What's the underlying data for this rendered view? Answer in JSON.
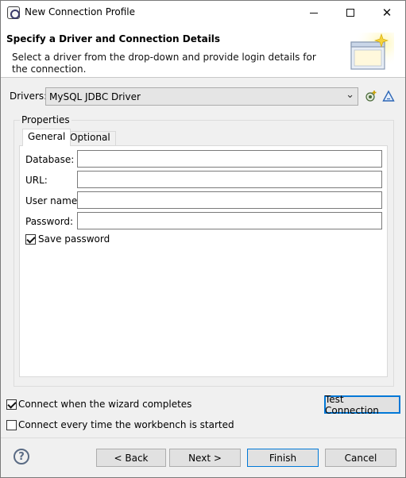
{
  "window": {
    "title": "New Connection Profile"
  },
  "header": {
    "title": "Specify a Driver and Connection Details",
    "description": "Select a driver from the drop-down and provide login details for the connection."
  },
  "drivers": {
    "label": "Drivers:",
    "selected": "MySQL JDBC Driver",
    "icons": [
      "new-driver-icon",
      "edit-driver-icon"
    ]
  },
  "properties": {
    "label": "Properties",
    "tabs": [
      {
        "label": "General",
        "active": true
      },
      {
        "label": "Optional",
        "active": false
      }
    ],
    "fields": [
      {
        "label": "Database:",
        "value": ""
      },
      {
        "label": "URL:",
        "value": ""
      },
      {
        "label": "User name:",
        "value": ""
      },
      {
        "label": "Password:",
        "value": ""
      }
    ],
    "save_password": {
      "label": "Save password",
      "checked": true
    }
  },
  "options": {
    "connect_on_finish": {
      "label": "Connect when the wizard completes",
      "checked": true
    },
    "connect_on_startup": {
      "label": "Connect every time the workbench is started",
      "checked": false
    },
    "test_connection_label": "Test Connection"
  },
  "footer": {
    "help_icon": "question-mark-icon",
    "back_label": "< Back",
    "next_label": "Next >",
    "finish_label": "Finish",
    "cancel_label": "Cancel"
  },
  "colors": {
    "accent": "#0078d7",
    "dialog_bg": "#f0f0f0"
  }
}
